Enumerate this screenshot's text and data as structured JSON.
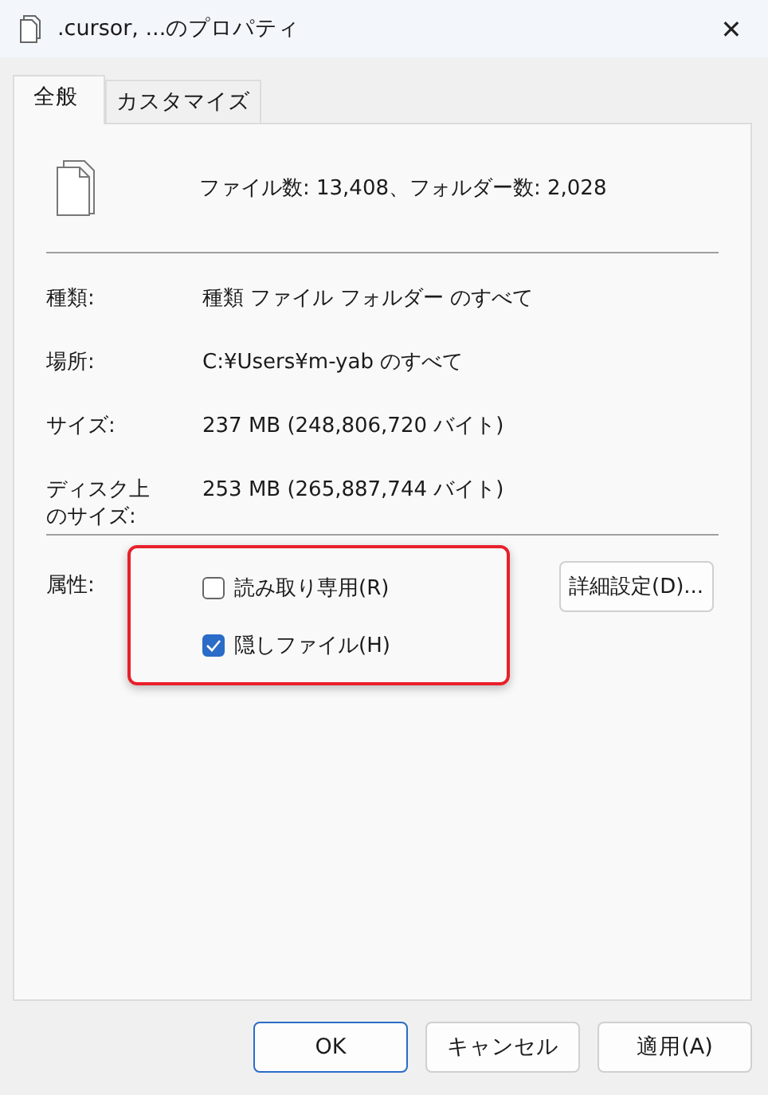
{
  "window": {
    "title": ".cursor, ...のプロパティ",
    "close": "✕"
  },
  "tabs": [
    {
      "label": "全般",
      "selected": true
    },
    {
      "label": "カスタマイズ",
      "selected": false
    }
  ],
  "summary": "ファイル数: 13,408、フォルダー数: 2,028",
  "properties": [
    {
      "label": "種類:",
      "value": "種類 ファイル フォルダー のすべて"
    },
    {
      "label": "場所:",
      "value": "C:¥Users¥m-yab のすべて"
    },
    {
      "label": "サイズ:",
      "value": "237 MB (248,806,720 バイト)"
    },
    {
      "label": "ディスク上のサイズ:",
      "value": "253 MB (265,887,744 バイト)"
    }
  ],
  "attributes": {
    "label": "属性:",
    "checkboxes": [
      {
        "label": "読み取り専用(R)",
        "checked": false
      },
      {
        "label": "隠しファイル(H)",
        "checked": true
      }
    ],
    "advanced_button": "詳細設定(D)..."
  },
  "buttons": [
    {
      "label": "OK",
      "default": true
    },
    {
      "label": "キャンセル",
      "default": false
    },
    {
      "label": "適用(A)",
      "default": false
    }
  ]
}
